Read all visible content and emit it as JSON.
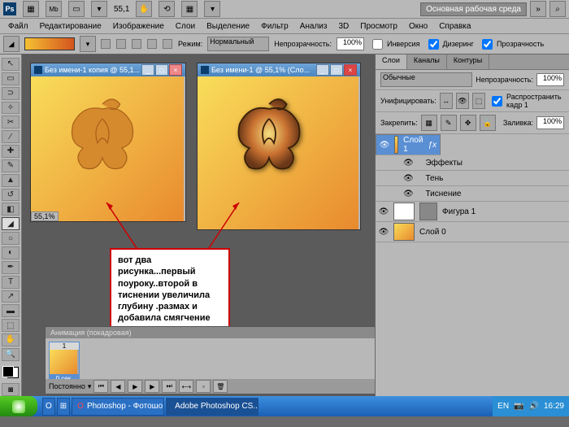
{
  "topbar": {
    "logo": "Ps",
    "zoom": "55,1",
    "workspace": "Основная рабочая среда"
  },
  "menu": [
    "Файл",
    "Редактирование",
    "Изображение",
    "Слои",
    "Выделение",
    "Фильтр",
    "Анализ",
    "3D",
    "Просмотр",
    "Окно",
    "Справка"
  ],
  "options": {
    "mode_label": "Режим:",
    "mode_value": "Нормальный",
    "opacity_label": "Непрозрачность:",
    "opacity_value": "100%",
    "inversion": "Инверсия",
    "dithering": "Дизеринг",
    "transparency": "Прозрачность"
  },
  "doc1": {
    "title": "Без имени-1 копия @ 55,1...",
    "zoom": "55,1%"
  },
  "doc2": {
    "title": "Без имени-1 @ 55,1% (Сло..."
  },
  "note": {
    "text": "вот два рисунка...первый поуроку..второй в тиснении увеличила глубину .размах и добавила смягчение"
  },
  "panels": {
    "tabs": [
      "Слои",
      "Каналы",
      "Контуры"
    ],
    "blend": "Обычные",
    "opacity_label": "Непрозрачность:",
    "opacity": "100%",
    "unify": "Унифицировать:",
    "propagate": "Распространить кадр 1",
    "lock": "Закрепить:",
    "fill_label": "Заливка:",
    "fill": "100%",
    "layers": [
      {
        "name": "Слой 1",
        "sel": true,
        "thumb": "main"
      },
      {
        "name": "Эффекты",
        "sub": true
      },
      {
        "name": "Тень",
        "sub": true
      },
      {
        "name": "Тиснение",
        "sub": true
      },
      {
        "name": "Фигура 1",
        "thumb": "shape"
      },
      {
        "name": "Слой 0",
        "thumb": "main"
      }
    ]
  },
  "anim": {
    "title": "Анимация (покадровая)",
    "frame_num": "1",
    "frame_time": "0 сек.",
    "loop": "Постоянно"
  },
  "taskbar": {
    "buttons": [
      "Photoshop - Фотошо...",
      "Adobe Photoshop CS..."
    ],
    "lang": "EN",
    "time": "16:29"
  }
}
